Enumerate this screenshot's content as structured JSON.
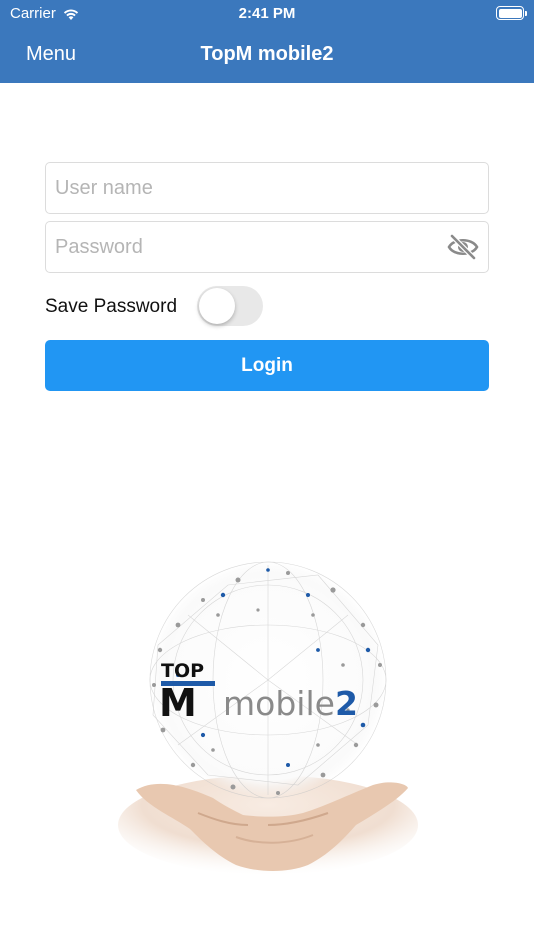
{
  "status_bar": {
    "carrier": "Carrier",
    "time": "2:41 PM"
  },
  "nav": {
    "menu_label": "Menu",
    "title": "TopM mobile2"
  },
  "form": {
    "username_placeholder": "User name",
    "password_placeholder": "Password",
    "save_password_label": "Save Password",
    "save_password_on": false,
    "login_label": "Login"
  },
  "logo": {
    "brand_top": "TOP",
    "brand_m": "M",
    "brand_word": "mobile",
    "brand_num": "2"
  },
  "colors": {
    "nav_bg": "#3b78bd",
    "login_bg": "#2196f3",
    "logo_blue": "#1e5aa8"
  }
}
